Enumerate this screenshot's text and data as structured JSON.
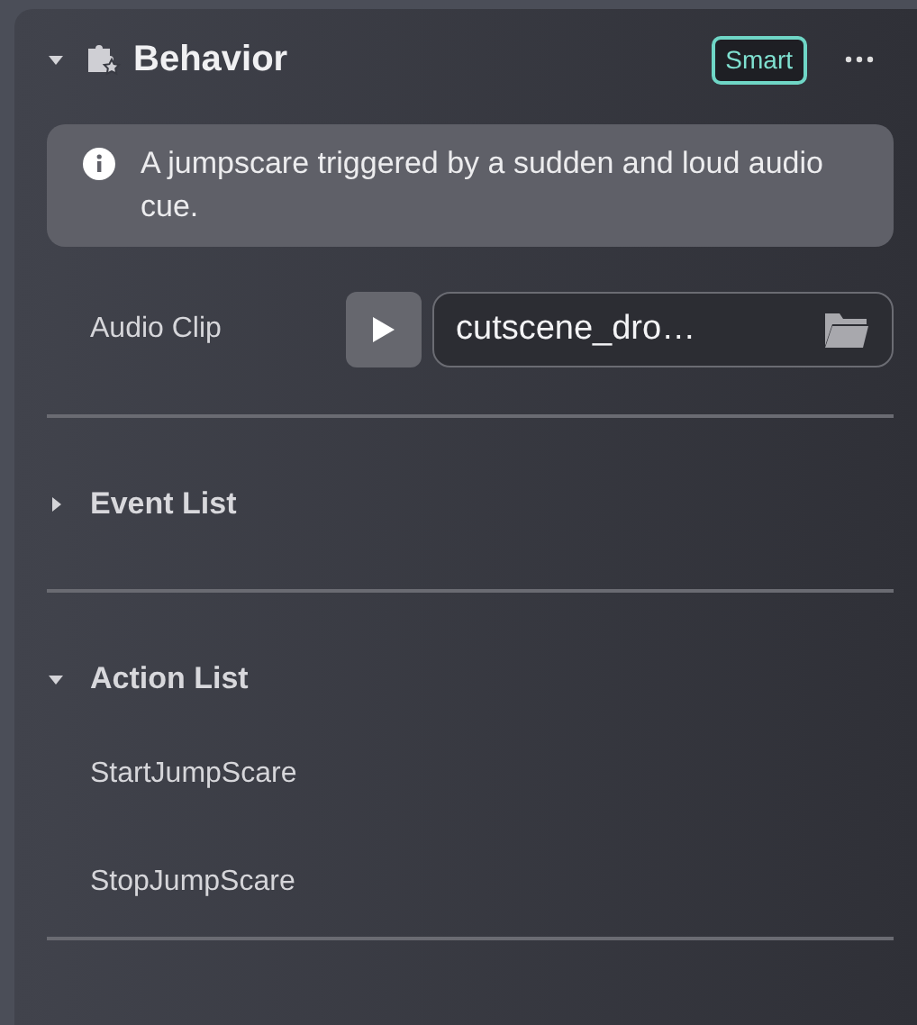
{
  "panel": {
    "title": "Behavior",
    "expanded": true,
    "badge": "Smart"
  },
  "info": "A jumpscare triggered by a sudden and loud audio cue.",
  "audio_clip": {
    "label": "Audio Clip",
    "value": "cutscene_dro…"
  },
  "sections": [
    {
      "title": "Event List",
      "expanded": false
    },
    {
      "title": "Action List",
      "expanded": true,
      "items": [
        "StartJumpScare",
        "StopJumpScare"
      ]
    }
  ]
}
